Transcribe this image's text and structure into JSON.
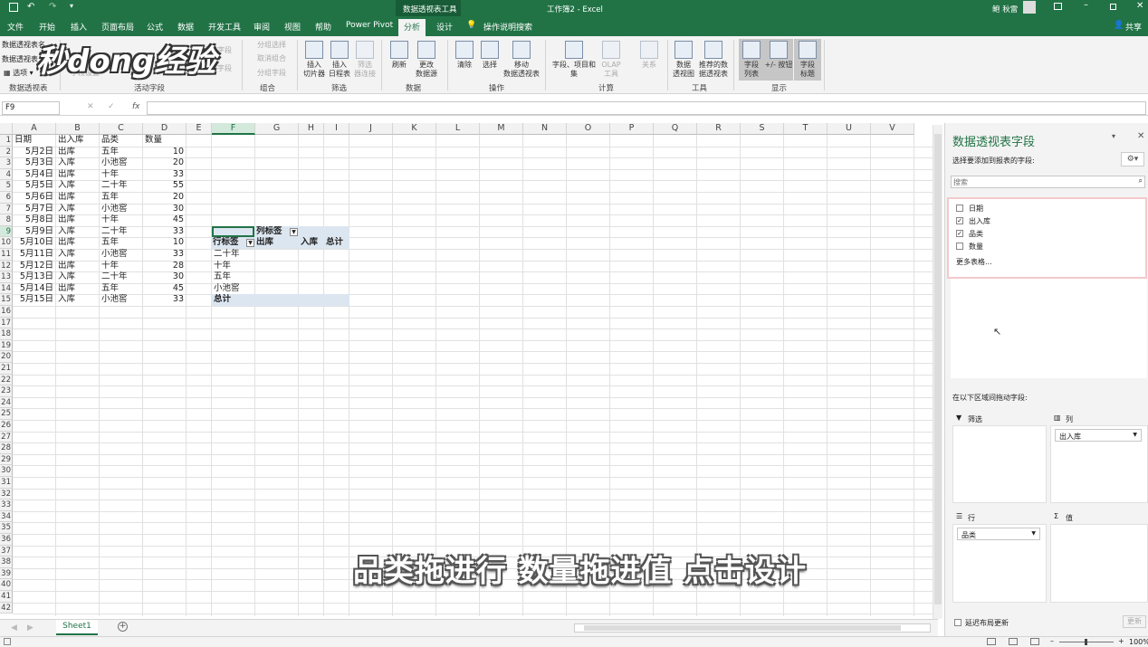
{
  "titlebar": {
    "context_tool": "数据透视表工具",
    "title": "工作簿2 - Excel",
    "user": "鲍 秋雷",
    "share": "共享"
  },
  "tabs": [
    "文件",
    "开始",
    "插入",
    "页面布局",
    "公式",
    "数据",
    "开发工具",
    "审阅",
    "视图",
    "帮助",
    "Power Pivot",
    "分析",
    "设计"
  ],
  "tell_me": "操作说明搜索",
  "ribbon": {
    "pt_name": "数据透视表名",
    "pt_sub": "数据透视表",
    "options": "选项",
    "group_pt": "数据透视表",
    "active_field_items": [
      "字段设置"
    ],
    "group_active": "活动字段",
    "expand": "展开字段",
    "collapse": "折叠字段",
    "group_items": [
      "分组选择",
      "取消组合",
      "分组字段"
    ],
    "group_group": "组合",
    "insert_slicer": "插入\n切片器",
    "insert_timeline": "插入\n日程表",
    "filter_conn": "筛选\n器连接",
    "group_filter": "筛选",
    "refresh": "刷新",
    "change_src": "更改\n数据源",
    "group_data": "数据",
    "clear": "清除",
    "select": "选择",
    "move": "移动\n数据透视表",
    "group_action": "操作",
    "fields_items": "字段、项目和\n集",
    "olap": "OLAP 工具",
    "relations": "关系",
    "group_calc": "计算",
    "pivotchart": "数据\n透视图",
    "recommended": "推荐的数\n据透视表",
    "group_tools": "工具",
    "field_list": "字段\n列表",
    "plus_minus": "+/- 按钮",
    "field_headers": "字段\n标题",
    "group_show": "显示"
  },
  "namebox": "F9",
  "columns": [
    "A",
    "B",
    "C",
    "D",
    "E",
    "F",
    "G",
    "H",
    "I",
    "J",
    "K",
    "L",
    "M",
    "N",
    "O",
    "P",
    "Q",
    "R",
    "S",
    "T",
    "U",
    "V"
  ],
  "rows": [
    "1",
    "2",
    "3",
    "4",
    "5",
    "6",
    "7",
    "8",
    "9",
    "10",
    "11",
    "12",
    "13",
    "14",
    "15",
    "16",
    "17",
    "18",
    "19",
    "20",
    "21",
    "22",
    "23",
    "24",
    "25",
    "26",
    "27",
    "28",
    "29",
    "30",
    "31",
    "32",
    "33",
    "34",
    "35",
    "36",
    "37",
    "38",
    "39",
    "40",
    "41",
    "42"
  ],
  "table": {
    "headers": [
      "日期",
      "出入库",
      "品类",
      "数量"
    ],
    "rows": [
      [
        "5月2日",
        "出库",
        "五年",
        "10"
      ],
      [
        "5月3日",
        "入库",
        "小池窖",
        "20"
      ],
      [
        "5月4日",
        "出库",
        "十年",
        "33"
      ],
      [
        "5月5日",
        "入库",
        "二十年",
        "55"
      ],
      [
        "5月6日",
        "出库",
        "五年",
        "20"
      ],
      [
        "5月7日",
        "入库",
        "小池窖",
        "30"
      ],
      [
        "5月8日",
        "出库",
        "十年",
        "45"
      ],
      [
        "5月9日",
        "入库",
        "二十年",
        "33"
      ],
      [
        "5月10日",
        "出库",
        "五年",
        "10"
      ],
      [
        "5月11日",
        "入库",
        "小池窖",
        "33"
      ],
      [
        "5月12日",
        "出库",
        "十年",
        "28"
      ],
      [
        "5月13日",
        "入库",
        "二十年",
        "30"
      ],
      [
        "5月14日",
        "出库",
        "五年",
        "45"
      ],
      [
        "5月15日",
        "入库",
        "小池窖",
        "33"
      ]
    ]
  },
  "pivot": {
    "col_label": "列标签",
    "row_label": "行标签",
    "out": "出库",
    "in": "入库",
    "total": "总计",
    "items": [
      "二十年",
      "十年",
      "五年",
      "小池窖"
    ],
    "grand_total": "总计"
  },
  "sheet_tab": "Sheet1",
  "pane": {
    "title": "数据透视表字段",
    "choose": "选择要添加到报表的字段:",
    "search_placeholder": "搜索",
    "fields": [
      {
        "name": "日期",
        "checked": false
      },
      {
        "name": "出入库",
        "checked": true
      },
      {
        "name": "品类",
        "checked": true
      },
      {
        "name": "数量",
        "checked": false
      }
    ],
    "more_tables": "更多表格...",
    "drag_label": "在以下区域间拖动字段:",
    "filters": "筛选",
    "columns": "列",
    "rows": "行",
    "values": "值",
    "col_item": "出入库",
    "row_item": "品类",
    "defer": "延迟布局更新",
    "update": "更新"
  },
  "status": {
    "zoom": "100%"
  },
  "subtitle": "品类拖进行 数量拖进值 点击设计",
  "logo": "秒dong经验"
}
